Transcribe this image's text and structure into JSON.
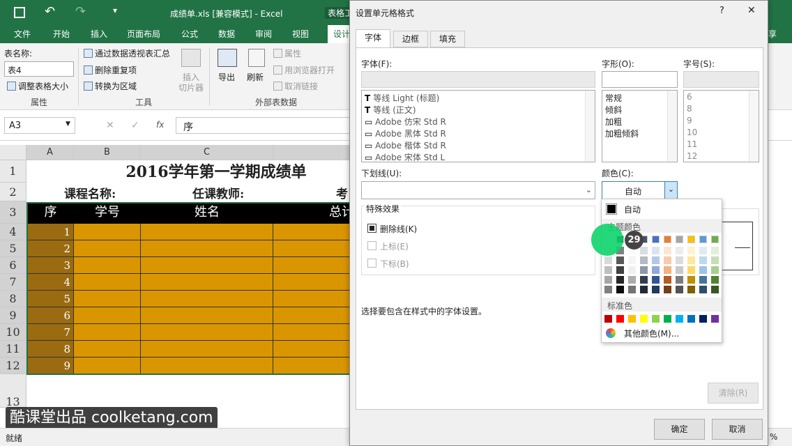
{
  "excel": {
    "title": "成绩单.xls  [兼容模式] - Excel",
    "context_tab": "表格工",
    "tabs": [
      "文件",
      "开始",
      "插入",
      "页面布局",
      "公式",
      "数据",
      "审阅",
      "视图",
      "设计"
    ],
    "share": "享",
    "ribbon": {
      "table_name_label": "表名称:",
      "table_name_value": "表4",
      "resize_table": "调整表格大小",
      "group_properties": "属性",
      "pivot": "通过数据透视表汇总",
      "remove_dup": "删除重复项",
      "convert_range": "转换为区域",
      "slicer_line1": "插入",
      "slicer_line2": "切片器",
      "group_tools": "工具",
      "export": "导出",
      "refresh": "刷新",
      "properties": "属性",
      "open_browser": "用浏览器打开",
      "unlink": "取消链接",
      "group_external": "外部表数据"
    },
    "namebox": "A3",
    "fx": "fx",
    "formula": "序",
    "columns": [
      "A",
      "B",
      "C"
    ],
    "rows": [
      "1",
      "2",
      "3",
      "4",
      "5",
      "6",
      "7",
      "8",
      "9",
      "10",
      "11",
      "12",
      "13"
    ],
    "sheet_title": "2016学年第一学期成绩单",
    "row2": [
      "课程名称:",
      "任课教师:",
      "考"
    ],
    "headers": [
      "序",
      "学号",
      "姓名",
      "总计"
    ],
    "seq": [
      "1",
      "2",
      "3",
      "4",
      "5",
      "6",
      "7",
      "8",
      "9"
    ],
    "status": "就绪",
    "zoom": "%"
  },
  "dialog": {
    "title": "设置单元格格式",
    "help": "?",
    "close": "✕",
    "tabs": [
      "字体",
      "边框",
      "填充"
    ],
    "font_label": "字体(F):",
    "font_list": [
      "等线 Light (标题)",
      "等线 (正文)",
      "Adobe 仿宋 Std R",
      "Adobe 黑体 Std R",
      "Adobe 楷体 Std R",
      "Adobe 宋体 Std L"
    ],
    "style_label": "字形(O):",
    "style_list": [
      "常规",
      "倾斜",
      "加粗",
      "加粗倾斜"
    ],
    "size_label": "字号(S):",
    "size_list": [
      "6",
      "8",
      "9",
      "10",
      "11",
      "12"
    ],
    "underline_label": "下划线(U):",
    "color_label": "颜色(C):",
    "color_value": "自动",
    "effects_label": "特殊效果",
    "strike": "删除线(K)",
    "superscript": "上标(E)",
    "subscript": "下标(B)",
    "hint": "选择要包含在样式中的字体设置。",
    "clear": "清除(R)",
    "ok": "确定",
    "cancel": "取消"
  },
  "color_popup": {
    "auto": "自动",
    "theme_title": "主题颜色",
    "standard_title": "标准色",
    "more": "其他颜色(M)...",
    "theme_columns": [
      "#ffffff",
      "#000000",
      "#e7e6e6",
      "#44546a",
      "#4472c4",
      "#ed7d31",
      "#a5a5a5",
      "#ffc000",
      "#5b9bd5",
      "#70ad47"
    ],
    "standard": [
      "#c00000",
      "#ff0000",
      "#ffc000",
      "#ffff00",
      "#92d050",
      "#00b050",
      "#00b0f0",
      "#0070c0",
      "#002060",
      "#7030a0"
    ]
  },
  "overlay": {
    "step": "29",
    "watermark": "酷课堂出品 coolketang.com"
  }
}
